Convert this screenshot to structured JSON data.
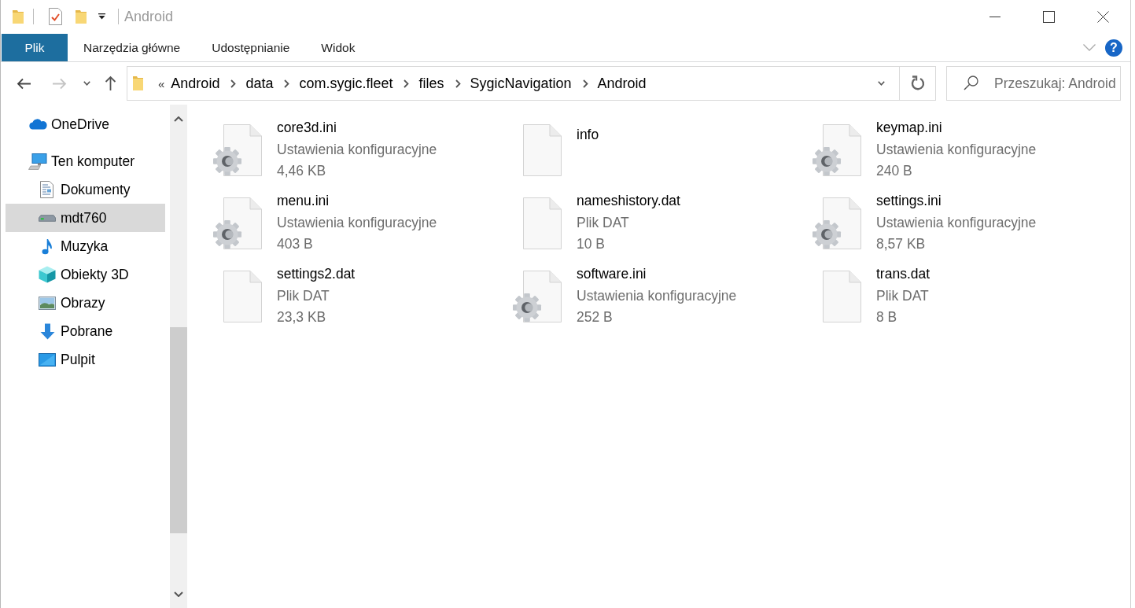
{
  "window": {
    "title": "Android"
  },
  "ribbon": {
    "tabs": [
      {
        "label": "Plik",
        "kind": "file"
      },
      {
        "label": "Narzędzia główne",
        "kind": "tab"
      },
      {
        "label": "Udostępnianie",
        "kind": "tab"
      },
      {
        "label": "Widok",
        "kind": "tab"
      }
    ],
    "help": "?"
  },
  "address_bar": {
    "overflow": "«",
    "path": [
      "Android",
      "data",
      "com.sygic.fleet",
      "files",
      "SygicNavigation",
      "Android"
    ]
  },
  "search": {
    "placeholder": "Przeszukaj: Android"
  },
  "navigation": {
    "items": [
      {
        "label": "OneDrive",
        "kind": "cloud",
        "selected": false
      },
      {
        "label": "Ten komputer",
        "kind": "computer",
        "selected": false,
        "children": [
          {
            "label": "Dokumenty",
            "kind": "documents",
            "selected": false
          },
          {
            "label": "mdt760",
            "kind": "drive",
            "selected": true
          },
          {
            "label": "Muzyka",
            "kind": "music",
            "selected": false
          },
          {
            "label": "Obiekty 3D",
            "kind": "cube",
            "selected": false
          },
          {
            "label": "Obrazy",
            "kind": "pictures",
            "selected": false
          },
          {
            "label": "Pobrane",
            "kind": "downloads",
            "selected": false
          },
          {
            "label": "Pulpit",
            "kind": "desktop",
            "selected": false
          }
        ]
      }
    ]
  },
  "files": [
    {
      "name": "core3d.ini",
      "type": "Ustawienia konfiguracyjne",
      "size": "4,46 KB",
      "kind": "settings"
    },
    {
      "name": "info",
      "kind": "plain"
    },
    {
      "name": "keymap.ini",
      "type": "Ustawienia konfiguracyjne",
      "size": "240 B",
      "kind": "settings"
    },
    {
      "name": "menu.ini",
      "type": "Ustawienia konfiguracyjne",
      "size": "403 B",
      "kind": "settings"
    },
    {
      "name": "nameshistory.dat",
      "type": "Plik DAT",
      "size": "10 B",
      "kind": "plain"
    },
    {
      "name": "settings.ini",
      "type": "Ustawienia konfiguracyjne",
      "size": "8,57 KB",
      "kind": "settings"
    },
    {
      "name": "settings2.dat",
      "type": "Plik DAT",
      "size": "23,3 KB",
      "kind": "plain"
    },
    {
      "name": "software.ini",
      "type": "Ustawienia konfiguracyjne",
      "size": "252 B",
      "kind": "settings"
    },
    {
      "name": "trans.dat",
      "type": "Plik DAT",
      "size": "8 B",
      "kind": "plain"
    }
  ]
}
